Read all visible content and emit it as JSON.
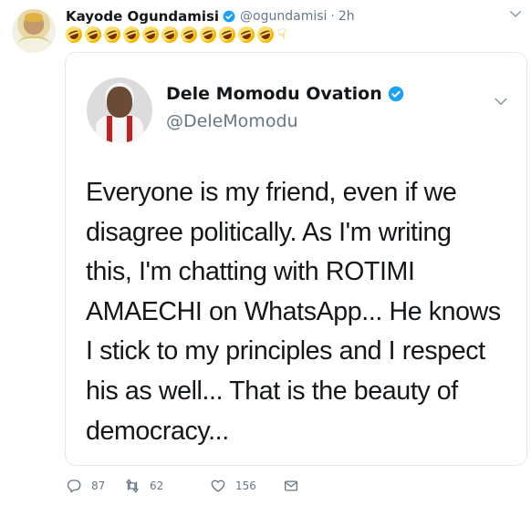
{
  "tweet": {
    "author_name": "Kayode Ogundamisi",
    "author_handle": "@ogundamisi",
    "separator": "·",
    "timestamp": "2h",
    "emoji_text": "🤣🤣🤣🤣🤣🤣🤣🤣🤣🤣🤣👇",
    "actions": {
      "replies": "87",
      "retweets": "62",
      "likes": "156"
    }
  },
  "quoted_tweet": {
    "author_name": "Dele Momodu Ovation",
    "author_handle": "@DeleMomodu",
    "text_lines": [
      "Everyone is my friend, even if we",
      "disagree politically. As I'm writing",
      "this, I'm chatting with ROTIMI",
      "AMAECHI on WhatsApp... He knows",
      "I stick to my principles and I respect",
      "his as well... That is the beauty of",
      "democracy..."
    ]
  },
  "colors": {
    "verified_blue": "#1da1f2",
    "muted_gray": "#657786",
    "border": "#e1e8ed"
  },
  "icons": [
    "verified-badge-icon",
    "chevron-down-icon",
    "reply-icon",
    "retweet-icon",
    "like-icon",
    "direct-message-icon",
    "laughing-emoji-icon",
    "pointing-down-emoji-icon"
  ]
}
